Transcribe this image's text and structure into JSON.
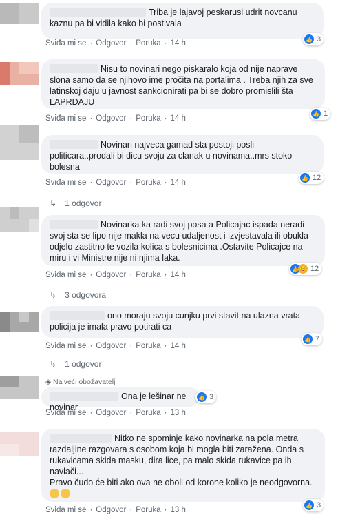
{
  "actions": {
    "like": "Sviđa mi se",
    "reply": "Odgovor",
    "share": "Poruka"
  },
  "comments": [
    {
      "text": "Triba je lajavoj peskarusi udrit novcanu kaznu pa bi vidila kako bi postivala",
      "time": "14 h",
      "reactions": "3"
    },
    {
      "text": "Nisu to novinari nego piskaralo koja od nije naprave slona samo da se njihovo ime pročita na portalima . Treba njih za sve latinskoj daju u javnost sankcionirati pa bi se dobro promislili šta LAPRDAJU",
      "time": "14 h",
      "reactions": "1"
    },
    {
      "text": "Novinari najveca gamad sta postoji posli politicara..prodali bi dicu svoju za clanak u novinama..mrs stoko bolesna",
      "time": "14 h",
      "reactions": "12",
      "replies": "1 odgovor"
    },
    {
      "text": "Novinarka ka radi svoj posa a Policajac ispada neradi svoj sta se lipo nije makla na vecu udaljenost i izvjestavala ili obukla odjelo zastitno te vozila kolica s bolesnicima .Ostavite Policajce na miru i vi Ministre nije ni njima laka.",
      "time": "14 h",
      "reactions": "12",
      "replies": "3 odgovora"
    },
    {
      "text": "ono moraju svoju cunjku prvi stavit na ulazna vrata policija je imala pravo potirati ca",
      "time": "14 h",
      "reactions": "7",
      "replies": "1 odgovor"
    },
    {
      "badge": "Najveći obožavatelj",
      "text": "Ona je lešinar ne novinar",
      "time": "13 h",
      "reactions": "3"
    },
    {
      "text": "Nitko ne spominje kako novinarka na pola metra razdaljine razgovara s osobom koja bi mogla biti zaražena. Onda s rukavicama skida masku, dira lice, pa malo skida rukavice pa ih navlači...",
      "text2": "Pravo čudo će biti ako ova ne oboli od korone koliko je neodgovorna.",
      "time": "13 h",
      "reactions": "3"
    }
  ]
}
